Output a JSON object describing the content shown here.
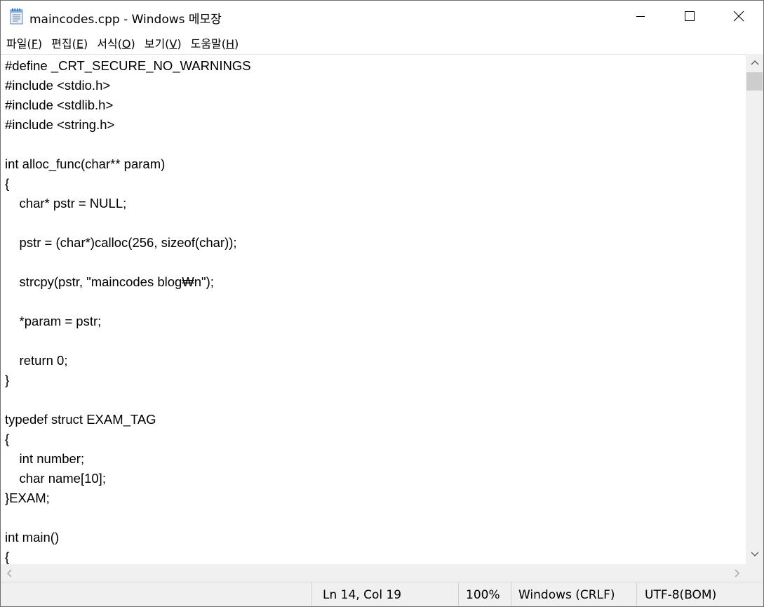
{
  "window": {
    "title": "maincodes.cpp - Windows 메모장"
  },
  "icons": {
    "app": "notepad-icon",
    "minimize": "minimize-icon",
    "maximize": "maximize-icon",
    "close": "close-icon"
  },
  "menu": {
    "items": [
      {
        "label": "파일(",
        "key": "F",
        "suffix": ")"
      },
      {
        "label": "편집(",
        "key": "E",
        "suffix": ")"
      },
      {
        "label": "서식(",
        "key": "O",
        "suffix": ")"
      },
      {
        "label": "보기(",
        "key": "V",
        "suffix": ")"
      },
      {
        "label": "도움말(",
        "key": "H",
        "suffix": ")"
      }
    ]
  },
  "editor": {
    "content": "#define _CRT_SECURE_NO_WARNINGS\n#include <stdio.h>\n#include <stdlib.h>\n#include <string.h>\n\nint alloc_func(char** param)\n{\n    char* pstr = NULL;\n\n    pstr = (char*)calloc(256, sizeof(char));\n\n    strcpy(pstr, \"maincodes blog₩n\");\n\n    *param = pstr;\n\n    return 0;\n}\n\ntypedef struct EXAM_TAG\n{\n    int number;\n    char name[10];\n}EXAM;\n\nint main()\n{"
  },
  "status": {
    "position": "Ln 14, Col 19",
    "zoom": "100%",
    "line_ending": "Windows (CRLF)",
    "encoding": "UTF-8(BOM)"
  }
}
